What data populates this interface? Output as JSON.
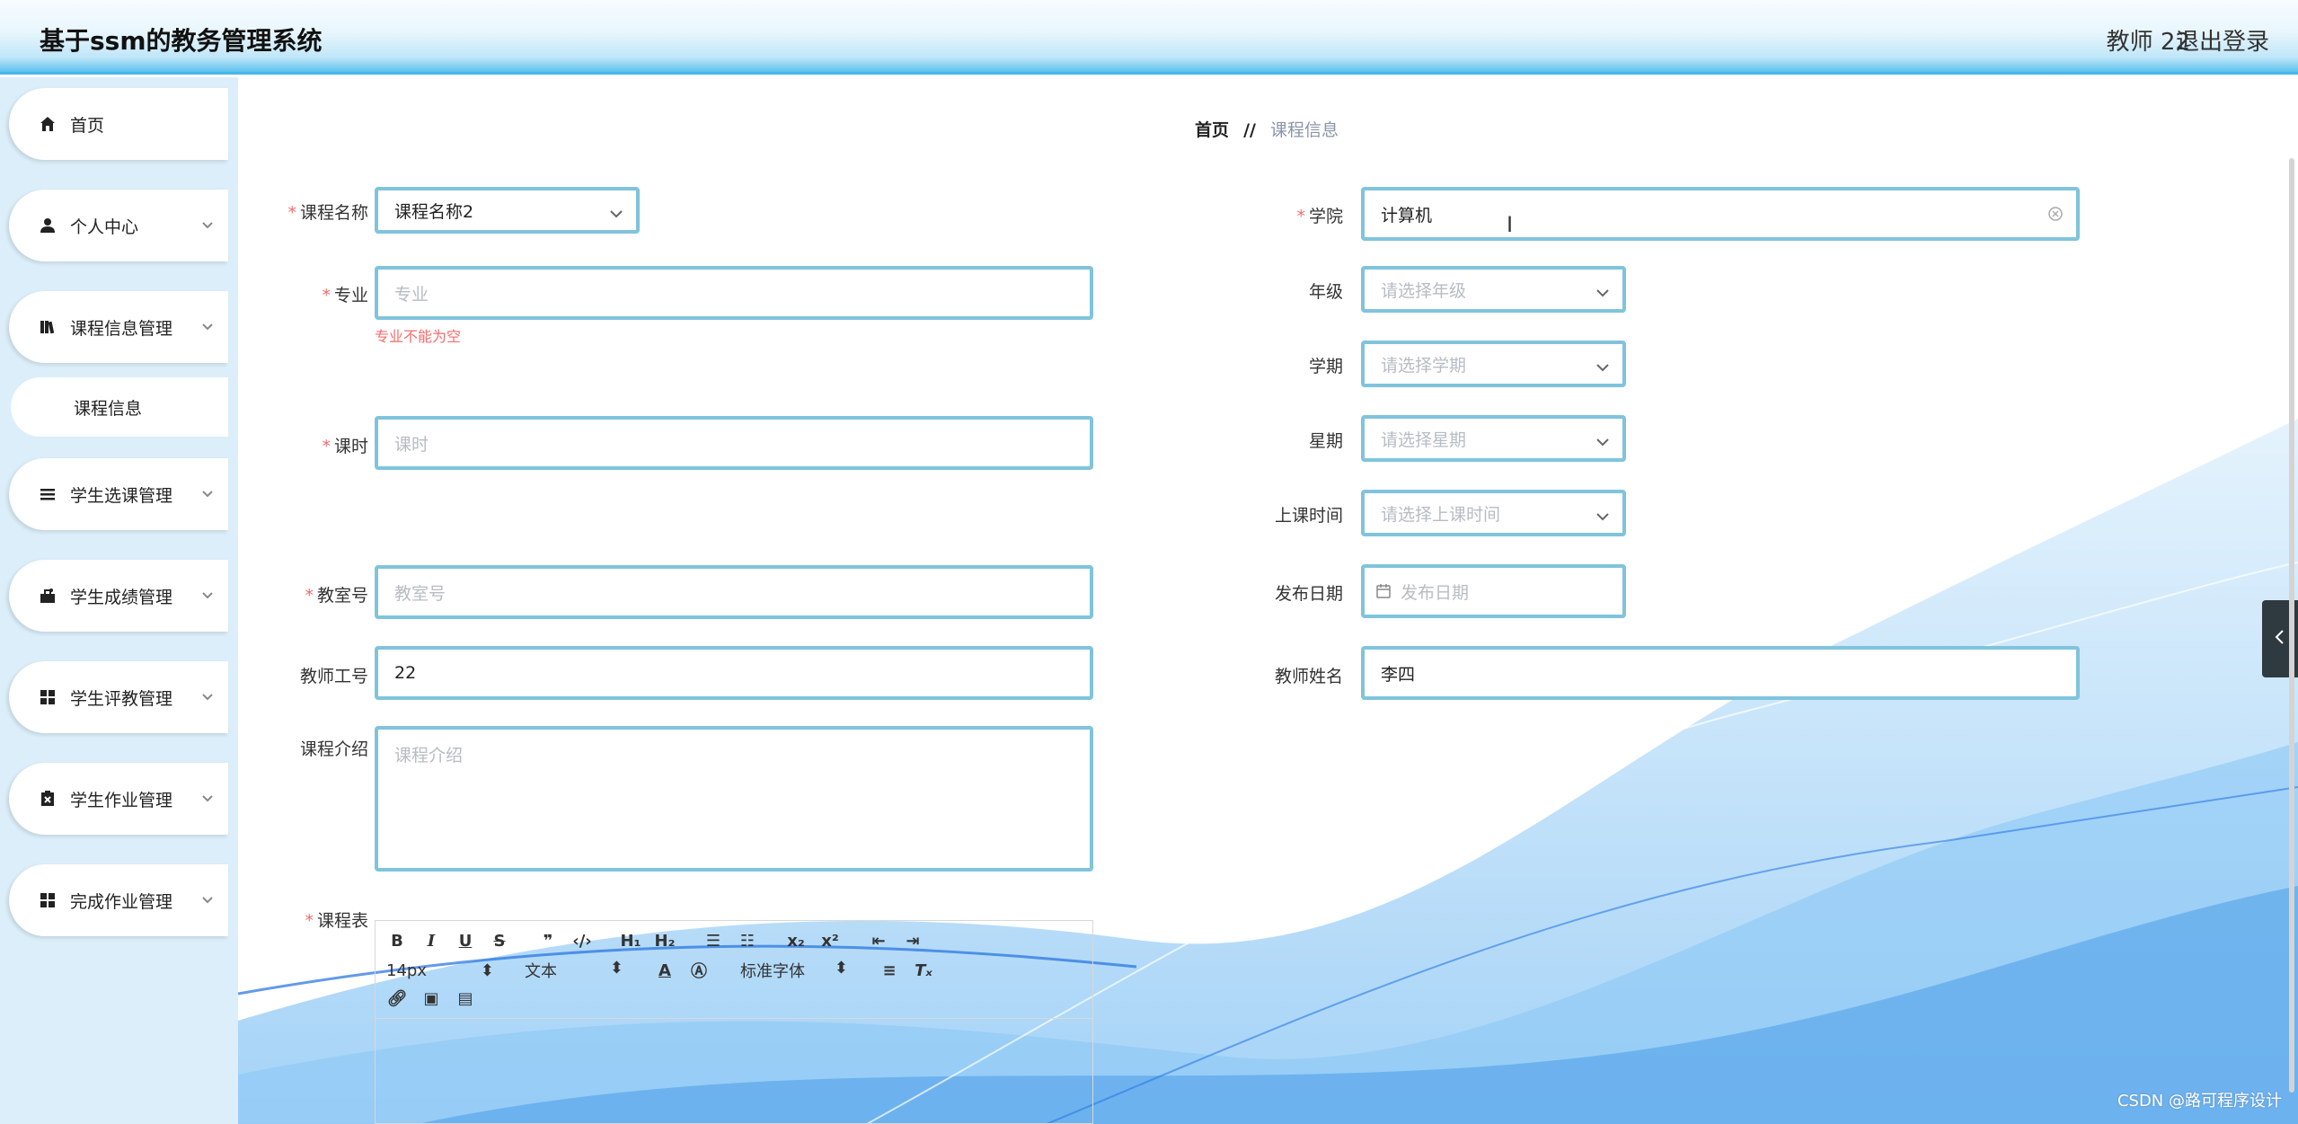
{
  "header": {
    "title": "基于ssm的教务管理系统",
    "user": "教师 22",
    "logout": "退出登录"
  },
  "sidebar": {
    "items": [
      {
        "label": "首页",
        "icon": "home-icon"
      },
      {
        "label": "个人中心",
        "icon": "user-icon"
      },
      {
        "label": "课程信息管理",
        "icon": "book-icon"
      },
      {
        "label": "课程信息",
        "icon": ""
      },
      {
        "label": "学生选课管理",
        "icon": "list-icon"
      },
      {
        "label": "学生成绩管理",
        "icon": "score-icon"
      },
      {
        "label": "学生评教管理",
        "icon": "grid-icon"
      },
      {
        "label": "学生作业管理",
        "icon": "clipboard-icon"
      },
      {
        "label": "完成作业管理",
        "icon": "grid-icon"
      }
    ]
  },
  "breadcrumb": {
    "home": "首页",
    "separator": "//",
    "current": "课程信息"
  },
  "form": {
    "course_name": {
      "label": "课程名称",
      "value": "课程名称2"
    },
    "major": {
      "label": "专业",
      "placeholder": "专业",
      "error": "专业不能为空"
    },
    "hours": {
      "label": "课时",
      "placeholder": "课时"
    },
    "classroom": {
      "label": "教室号",
      "placeholder": "教室号"
    },
    "teacher_id": {
      "label": "教师工号",
      "value": "22"
    },
    "intro": {
      "label": "课程介绍",
      "placeholder": "课程介绍"
    },
    "schedule": {
      "label": "课程表"
    },
    "college": {
      "label": "学院",
      "value": "计算机"
    },
    "grade": {
      "label": "年级",
      "placeholder": "请选择年级"
    },
    "term": {
      "label": "学期",
      "placeholder": "请选择学期"
    },
    "weekday": {
      "label": "星期",
      "placeholder": "请选择星期"
    },
    "class_time": {
      "label": "上课时间",
      "placeholder": "请选择上课时间"
    },
    "publish_date": {
      "label": "发布日期",
      "placeholder": "发布日期"
    },
    "teacher_name": {
      "label": "教师姓名",
      "value": "李四"
    }
  },
  "editor": {
    "font_size": "14px",
    "text_style": "文本",
    "font_family": "标准字体"
  },
  "watermark": "CSDN @路可程序设计",
  "colors": {
    "accent": "#49b6ea",
    "field_border": "#7fc4dc",
    "required": "#f56c6c",
    "sidebar_bg": "#dbeef9"
  }
}
